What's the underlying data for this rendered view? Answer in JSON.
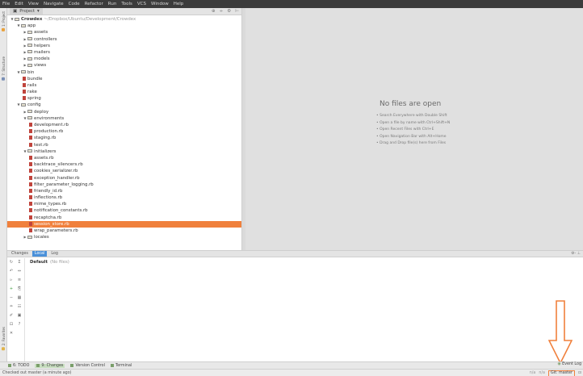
{
  "menu": [
    "File",
    "Edit",
    "View",
    "Navigate",
    "Code",
    "Refactor",
    "Run",
    "Tools",
    "VCS",
    "Window",
    "Help"
  ],
  "project_panel": {
    "tab_label": "Project",
    "header_icons": [
      "⊕",
      "÷",
      "⚙",
      "⊢"
    ],
    "tree": [
      {
        "indent": 0,
        "type": "folder",
        "arrow": "▼",
        "label": "Crowdex",
        "bold": true,
        "path": "~/Dropbox/Ubuntu/Development/Crowdex"
      },
      {
        "indent": 1,
        "type": "folder",
        "arrow": "▼",
        "label": "app"
      },
      {
        "indent": 2,
        "type": "folder",
        "arrow": "▶",
        "label": "assets"
      },
      {
        "indent": 2,
        "type": "folder",
        "arrow": "▶",
        "label": "controllers"
      },
      {
        "indent": 2,
        "type": "folder",
        "arrow": "▶",
        "label": "helpers"
      },
      {
        "indent": 2,
        "type": "folder",
        "arrow": "▶",
        "label": "mailers"
      },
      {
        "indent": 2,
        "type": "folder",
        "arrow": "▶",
        "label": "models"
      },
      {
        "indent": 2,
        "type": "folder",
        "arrow": "▶",
        "label": "views"
      },
      {
        "indent": 1,
        "type": "folder",
        "arrow": "▼",
        "label": "bin"
      },
      {
        "indent": 2,
        "type": "file",
        "label": "bundle"
      },
      {
        "indent": 2,
        "type": "file",
        "label": "rails"
      },
      {
        "indent": 2,
        "type": "file",
        "label": "rake"
      },
      {
        "indent": 2,
        "type": "file",
        "label": "spring"
      },
      {
        "indent": 1,
        "type": "folder",
        "arrow": "▼",
        "label": "config"
      },
      {
        "indent": 2,
        "type": "folder",
        "arrow": "▶",
        "label": "deploy"
      },
      {
        "indent": 2,
        "type": "folder",
        "arrow": "▼",
        "label": "environments"
      },
      {
        "indent": 3,
        "type": "file",
        "label": "development.rb"
      },
      {
        "indent": 3,
        "type": "file",
        "label": "production.rb"
      },
      {
        "indent": 3,
        "type": "file",
        "label": "staging.rb"
      },
      {
        "indent": 3,
        "type": "file",
        "label": "test.rb"
      },
      {
        "indent": 2,
        "type": "folder",
        "arrow": "▼",
        "label": "initializers"
      },
      {
        "indent": 3,
        "type": "file",
        "label": "assets.rb"
      },
      {
        "indent": 3,
        "type": "file",
        "label": "backtrace_silencers.rb"
      },
      {
        "indent": 3,
        "type": "file",
        "label": "cookies_serializer.rb"
      },
      {
        "indent": 3,
        "type": "file",
        "label": "exception_handler.rb"
      },
      {
        "indent": 3,
        "type": "file",
        "label": "filter_parameter_logging.rb"
      },
      {
        "indent": 3,
        "type": "file",
        "label": "friendly_id.rb"
      },
      {
        "indent": 3,
        "type": "file",
        "label": "inflections.rb"
      },
      {
        "indent": 3,
        "type": "file",
        "label": "mime_types.rb"
      },
      {
        "indent": 3,
        "type": "file",
        "label": "notification_constants.rb"
      },
      {
        "indent": 3,
        "type": "file",
        "label": "recaptcha.rb"
      },
      {
        "indent": 3,
        "type": "file",
        "label": "session_store.rb",
        "selected": true
      },
      {
        "indent": 3,
        "type": "file",
        "label": "wrap_parameters.rb"
      },
      {
        "indent": 2,
        "type": "folder",
        "arrow": "▶",
        "label": "locales"
      }
    ]
  },
  "editor": {
    "empty_title": "No files are open",
    "hints": [
      "• Search Everywhere with Double Shift",
      "• Open a file by name with Ctrl+Shift+N",
      "• Open Recent Files with Ctrl+E",
      "• Open Navigation Bar with Alt+Home",
      "• Drag and Drop file(s) here from Files"
    ]
  },
  "changes_panel": {
    "tabs": [
      "Changes",
      "Local",
      "Log"
    ],
    "active_tab": "Local",
    "right_icons": "⚙- ⊥",
    "changelist_name": "Default",
    "changelist_status": "(No files)"
  },
  "left_strip": {
    "project_label": "1: Project",
    "structure_label": "7: Structure",
    "favorites_label": "2: Favorites"
  },
  "bottom_tabs": [
    {
      "label": "6: TODO"
    },
    {
      "label": "9: Changes",
      "active": true
    },
    {
      "label": "Version Control"
    },
    {
      "label": "Terminal"
    }
  ],
  "event_log": "Event Log",
  "status": {
    "text": "Checked out master (a minute ago)",
    "git_branch": "Git: master",
    "misc": [
      "n/a",
      "n/a"
    ]
  },
  "colors": {
    "selection": "#f0803c",
    "highlight_box": "#f0803c",
    "arrow": "#f0803c"
  }
}
